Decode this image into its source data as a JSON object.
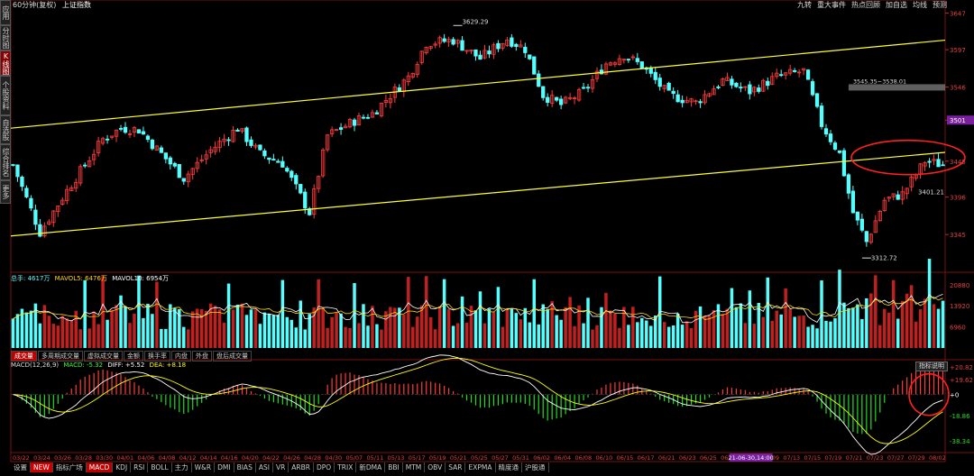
{
  "sidebar_tabs": [
    "应用",
    "分时图",
    "K线图",
    "个股资料",
    "自选股",
    "综合排名",
    "更多"
  ],
  "header": {
    "period": "60分钟(复权)",
    "index_name": "上证指数",
    "menu": [
      "九转",
      "重大事件",
      "热点回顾",
      "加自选",
      "均线",
      "预测"
    ]
  },
  "colors": {
    "up": "#ff3b3b",
    "down": "#54ffff",
    "up_vol": "#c21f1f",
    "channel": "#ffff33",
    "ma5": "#ffffff",
    "ma10": "#ffd700",
    "dif": "#ffffff",
    "dea": "#ffff00",
    "highlight_circle": "#ff2020"
  },
  "chart_data": [
    {
      "type": "candlestick",
      "title": "",
      "y_ticks": [
        "3647",
        "3597",
        "3546",
        "3501",
        "3445",
        "3396",
        "3345"
      ],
      "ylim": [
        3296,
        3650
      ],
      "annotations": {
        "high": "3629.29",
        "low": "3312.72",
        "last": "3401.21",
        "range": "3545.35~3538.01",
        "marker_label": "3501",
        "current_label": "3445"
      },
      "anchors": [
        {
          "i": 0,
          "v": 3440
        },
        {
          "i": 6,
          "v": 3348
        },
        {
          "i": 12,
          "v": 3405
        },
        {
          "i": 20,
          "v": 3475
        },
        {
          "i": 24,
          "v": 3490
        },
        {
          "i": 28,
          "v": 3488
        },
        {
          "i": 33,
          "v": 3455
        },
        {
          "i": 38,
          "v": 3422
        },
        {
          "i": 44,
          "v": 3460
        },
        {
          "i": 50,
          "v": 3490
        },
        {
          "i": 55,
          "v": 3455
        },
        {
          "i": 60,
          "v": 3442
        },
        {
          "i": 66,
          "v": 3375
        },
        {
          "i": 70,
          "v": 3480
        },
        {
          "i": 76,
          "v": 3500
        },
        {
          "i": 80,
          "v": 3510
        },
        {
          "i": 88,
          "v": 3560
        },
        {
          "i": 92,
          "v": 3606
        },
        {
          "i": 98,
          "v": 3610
        },
        {
          "i": 104,
          "v": 3585
        },
        {
          "i": 110,
          "v": 3612
        },
        {
          "i": 114,
          "v": 3598
        },
        {
          "i": 118,
          "v": 3535
        },
        {
          "i": 122,
          "v": 3522
        },
        {
          "i": 127,
          "v": 3540
        },
        {
          "i": 132,
          "v": 3578
        },
        {
          "i": 136,
          "v": 3590
        },
        {
          "i": 140,
          "v": 3575
        },
        {
          "i": 146,
          "v": 3535
        },
        {
          "i": 152,
          "v": 3525
        },
        {
          "i": 158,
          "v": 3555
        },
        {
          "i": 164,
          "v": 3540
        },
        {
          "i": 170,
          "v": 3560
        },
        {
          "i": 176,
          "v": 3568
        },
        {
          "i": 180,
          "v": 3495
        },
        {
          "i": 184,
          "v": 3455
        },
        {
          "i": 187,
          "v": 3375
        },
        {
          "i": 190,
          "v": 3335
        },
        {
          "i": 194,
          "v": 3392
        },
        {
          "i": 198,
          "v": 3400
        },
        {
          "i": 203,
          "v": 3445
        },
        {
          "i": 207,
          "v": 3440
        }
      ]
    },
    {
      "type": "bar",
      "title": "",
      "label_total": "总手: 4617万",
      "label_ma5": "MAVOL5: 6476万",
      "label_ma10": "MAVOL10: 6954万",
      "y_ticks": [
        "20880",
        "13920",
        "6960"
      ],
      "ylim": [
        0,
        22000
      ]
    },
    {
      "type": "bar",
      "title": "",
      "label_params": "MACD(12,26,9)",
      "label_macd": "MACD: -5.32",
      "label_diff": "DIFF: +5.52",
      "label_dea": "DEA: +8.18",
      "y_ticks": [
        "+20.82",
        "+19.62",
        "+0",
        "-18.86",
        "-38.34"
      ],
      "ylim": [
        -45,
        25
      ]
    }
  ],
  "x_axis": {
    "dates": [
      "03/22",
      "03/24",
      "03/26",
      "03/28",
      "03/30",
      "04/01",
      "04/06",
      "04/08",
      "04/12",
      "04/14",
      "04/16",
      "04/20",
      "04/22",
      "04/26",
      "04/28",
      "04/30",
      "05/07",
      "05/11",
      "05/13",
      "05/17",
      "05/19",
      "05/21",
      "05/25",
      "05/27",
      "05/31",
      "06/02",
      "06/04",
      "06/08",
      "06/10",
      "06/15",
      "06/17",
      "06/21",
      "06/23",
      "06/25",
      "06/29",
      "07/07",
      "07/09",
      "07/13",
      "07/15",
      "07/19",
      "07/21",
      "07/23",
      "07/27",
      "07/29",
      "08/02"
    ],
    "highlight": "21-06-30,14:00"
  },
  "volume_tabs": [
    "成交量",
    "多周期成交量",
    "虚拟成交量",
    "金额",
    "换手率",
    "内盘",
    "外盘",
    "盘后成交量"
  ],
  "indicator_explain": "指标说明",
  "bottom_tabs": [
    "设置",
    "NEW",
    "指标广场",
    "MACD",
    "KDJ",
    "RSI",
    "BOLL",
    "主力",
    "W&R",
    "DMI",
    "BIAS",
    "ASI",
    "VR",
    "ARBR",
    "DPO",
    "TRIX",
    "新DMA",
    "BBI",
    "MTM",
    "OBV",
    "SAR",
    "EXPMA",
    "精度通",
    "沪股通"
  ],
  "active_indicator": "MACD"
}
